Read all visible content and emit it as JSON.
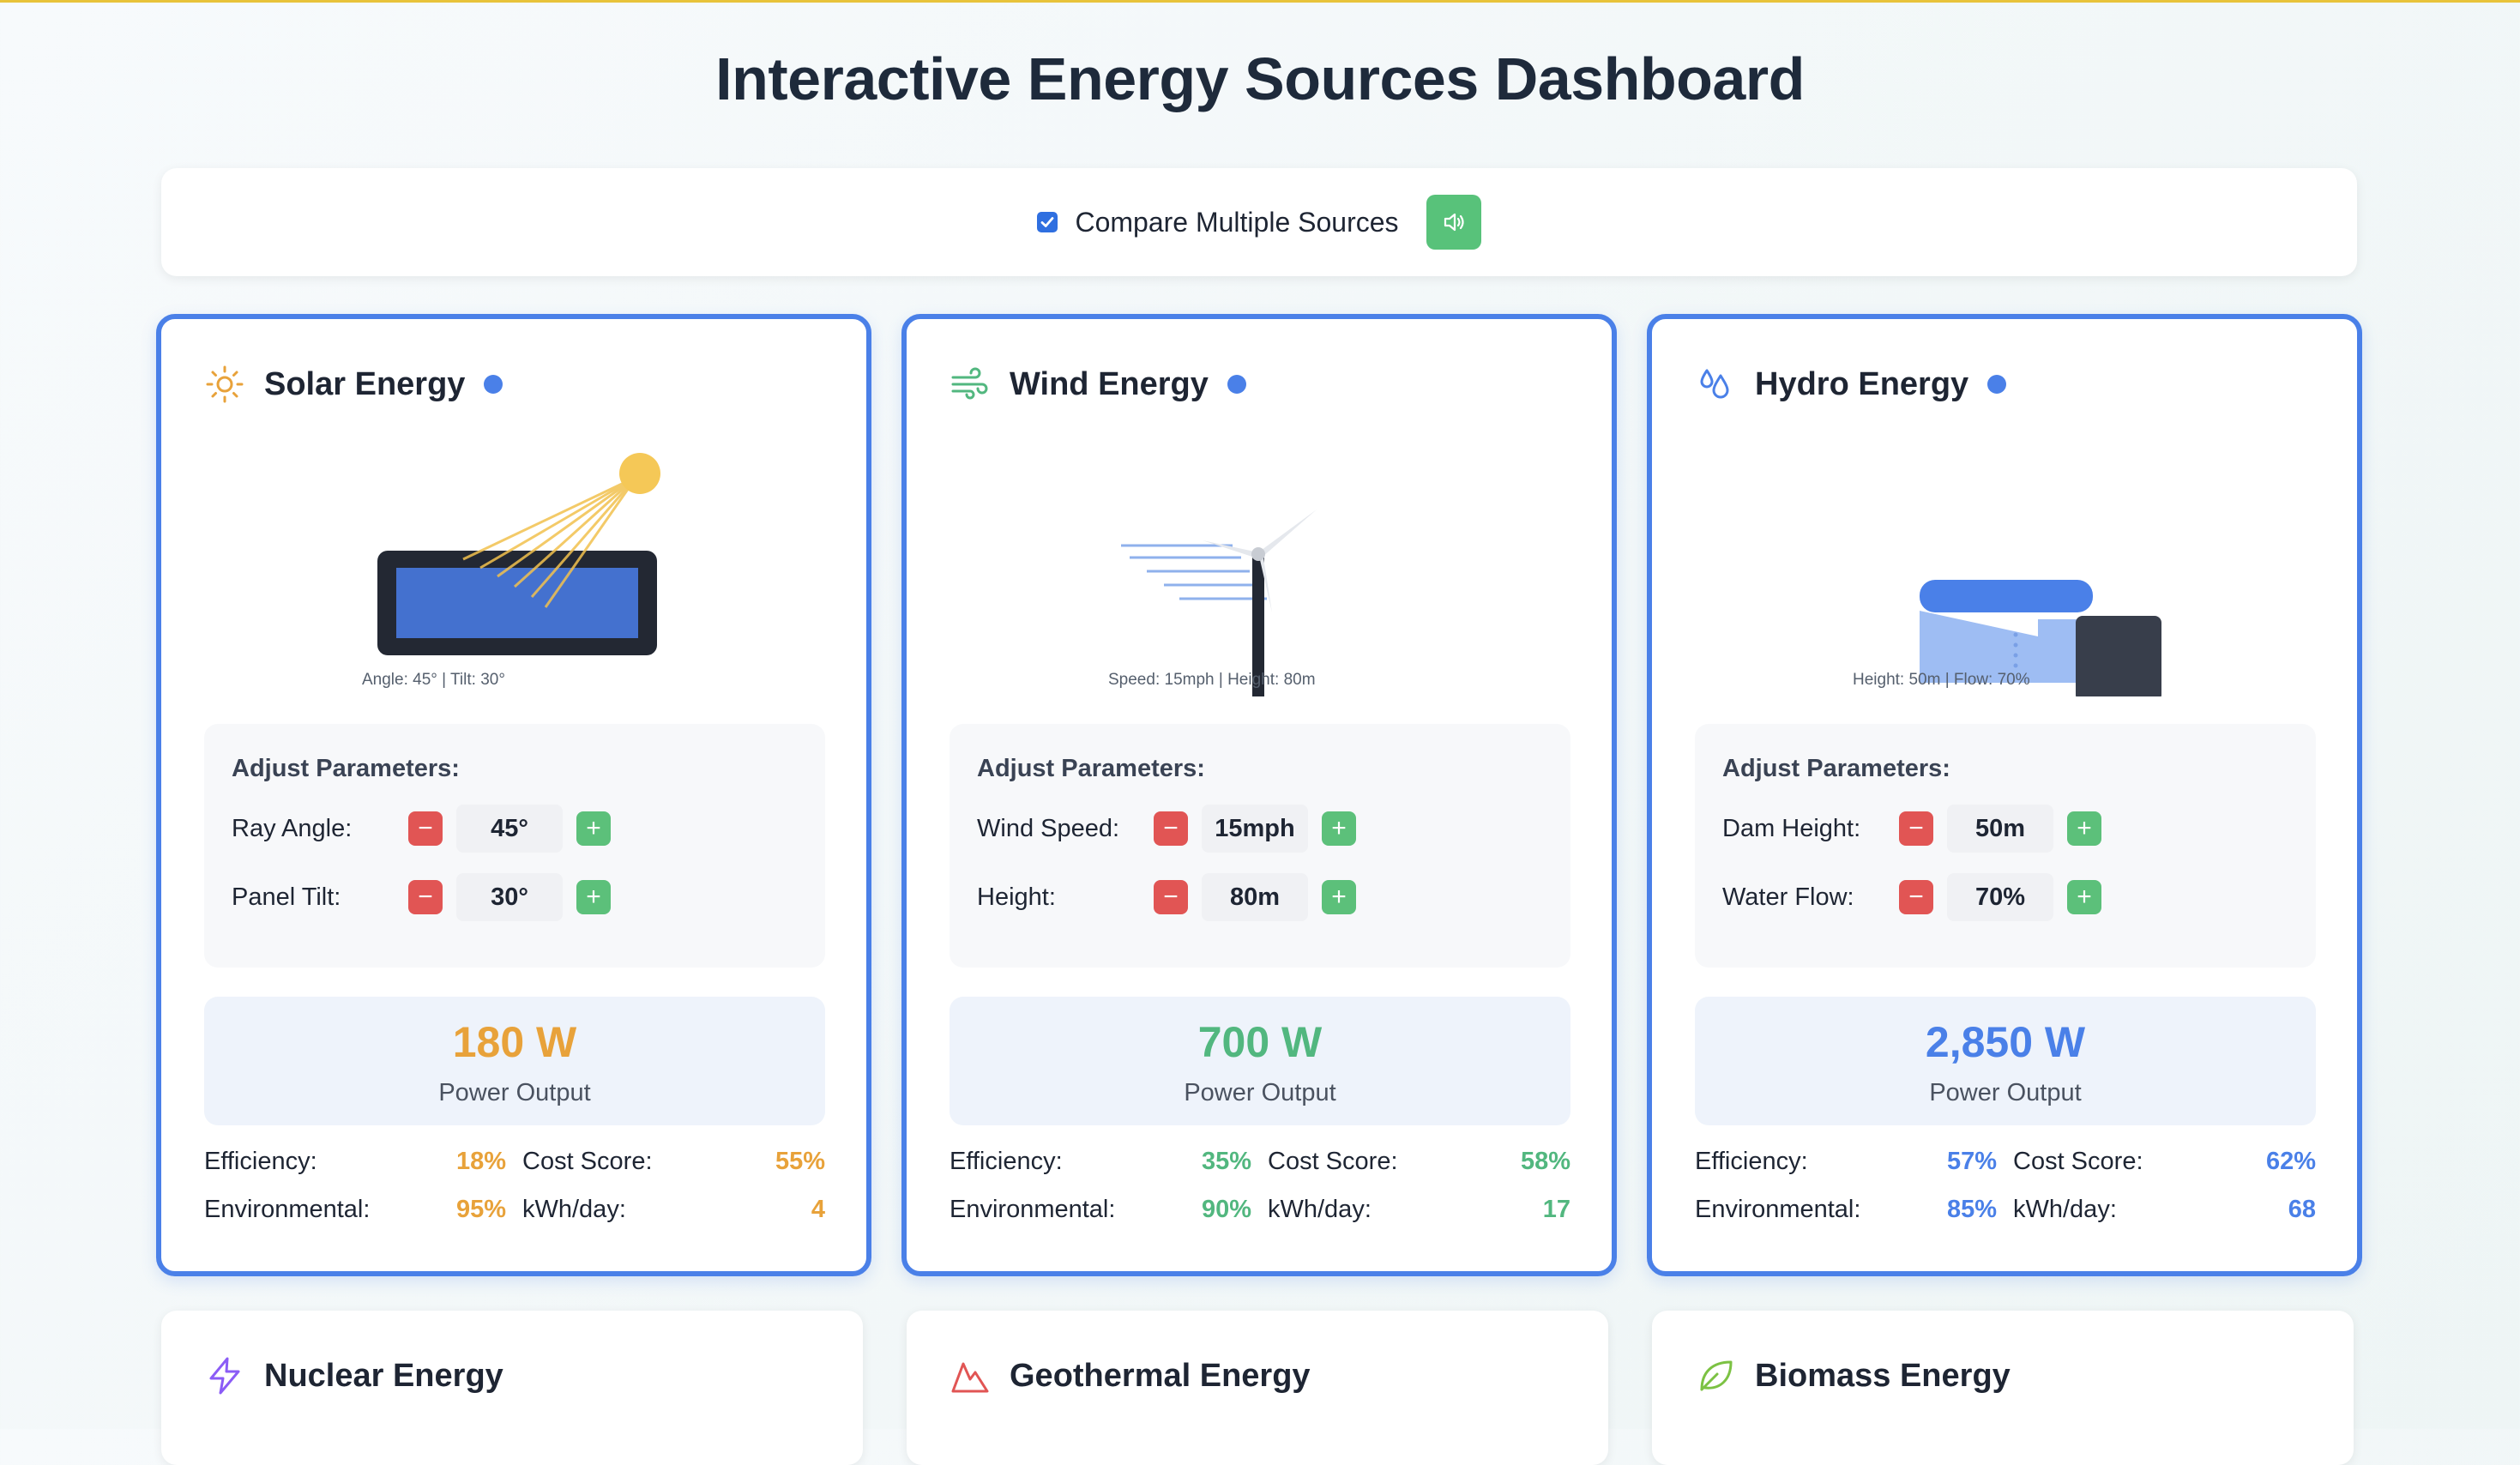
{
  "page": {
    "title": "Interactive Energy Sources Dashboard"
  },
  "toolbar": {
    "compare_label": "Compare Multiple Sources",
    "compare_checked": true,
    "sound_icon": "speaker-icon"
  },
  "cards": [
    {
      "title": "Solar Energy",
      "icon": "sun-icon",
      "accent": "#e8a23a",
      "caption": "Angle: 45° | Tilt: 30°",
      "params_title": "Adjust Parameters:",
      "params": [
        {
          "label": "Ray Angle:",
          "value": "45°"
        },
        {
          "label": "Panel Tilt:",
          "value": "30°"
        }
      ],
      "output_value": "180 W",
      "output_label": "Power Output",
      "stats": {
        "efficiency_label": "Efficiency:",
        "efficiency": "18%",
        "cost_label": "Cost Score:",
        "cost": "55%",
        "env_label": "Environmental:",
        "env": "95%",
        "kwh_label": "kWh/day:",
        "kwh": "4"
      }
    },
    {
      "title": "Wind Energy",
      "icon": "wind-icon",
      "accent": "#52b77f",
      "caption": "Speed: 15mph | Height: 80m",
      "params_title": "Adjust Parameters:",
      "params": [
        {
          "label": "Wind Speed:",
          "value": "15mph"
        },
        {
          "label": "Height:",
          "value": "80m"
        }
      ],
      "output_value": "700 W",
      "output_label": "Power Output",
      "stats": {
        "efficiency_label": "Efficiency:",
        "efficiency": "35%",
        "cost_label": "Cost Score:",
        "cost": "58%",
        "env_label": "Environmental:",
        "env": "90%",
        "kwh_label": "kWh/day:",
        "kwh": "17"
      }
    },
    {
      "title": "Hydro Energy",
      "icon": "water-drops-icon",
      "accent": "#4a80e8",
      "caption": "Height: 50m | Flow: 70%",
      "params_title": "Adjust Parameters:",
      "params": [
        {
          "label": "Dam Height:",
          "value": "50m"
        },
        {
          "label": "Water Flow:",
          "value": "70%"
        }
      ],
      "output_value": "2,850 W",
      "output_label": "Power Output",
      "stats": {
        "efficiency_label": "Efficiency:",
        "efficiency": "57%",
        "cost_label": "Cost Score:",
        "cost": "62%",
        "env_label": "Environmental:",
        "env": "85%",
        "kwh_label": "kWh/day:",
        "kwh": "68"
      }
    }
  ],
  "more_cards": [
    {
      "title": "Nuclear Energy",
      "icon": "lightning-icon",
      "accent": "#8b5cf6"
    },
    {
      "title": "Geothermal Energy",
      "icon": "mountain-icon",
      "accent": "#e15554"
    },
    {
      "title": "Biomass Energy",
      "icon": "leaf-icon",
      "accent": "#7cc243"
    }
  ],
  "controls": {
    "minus": "−",
    "plus": "+"
  }
}
